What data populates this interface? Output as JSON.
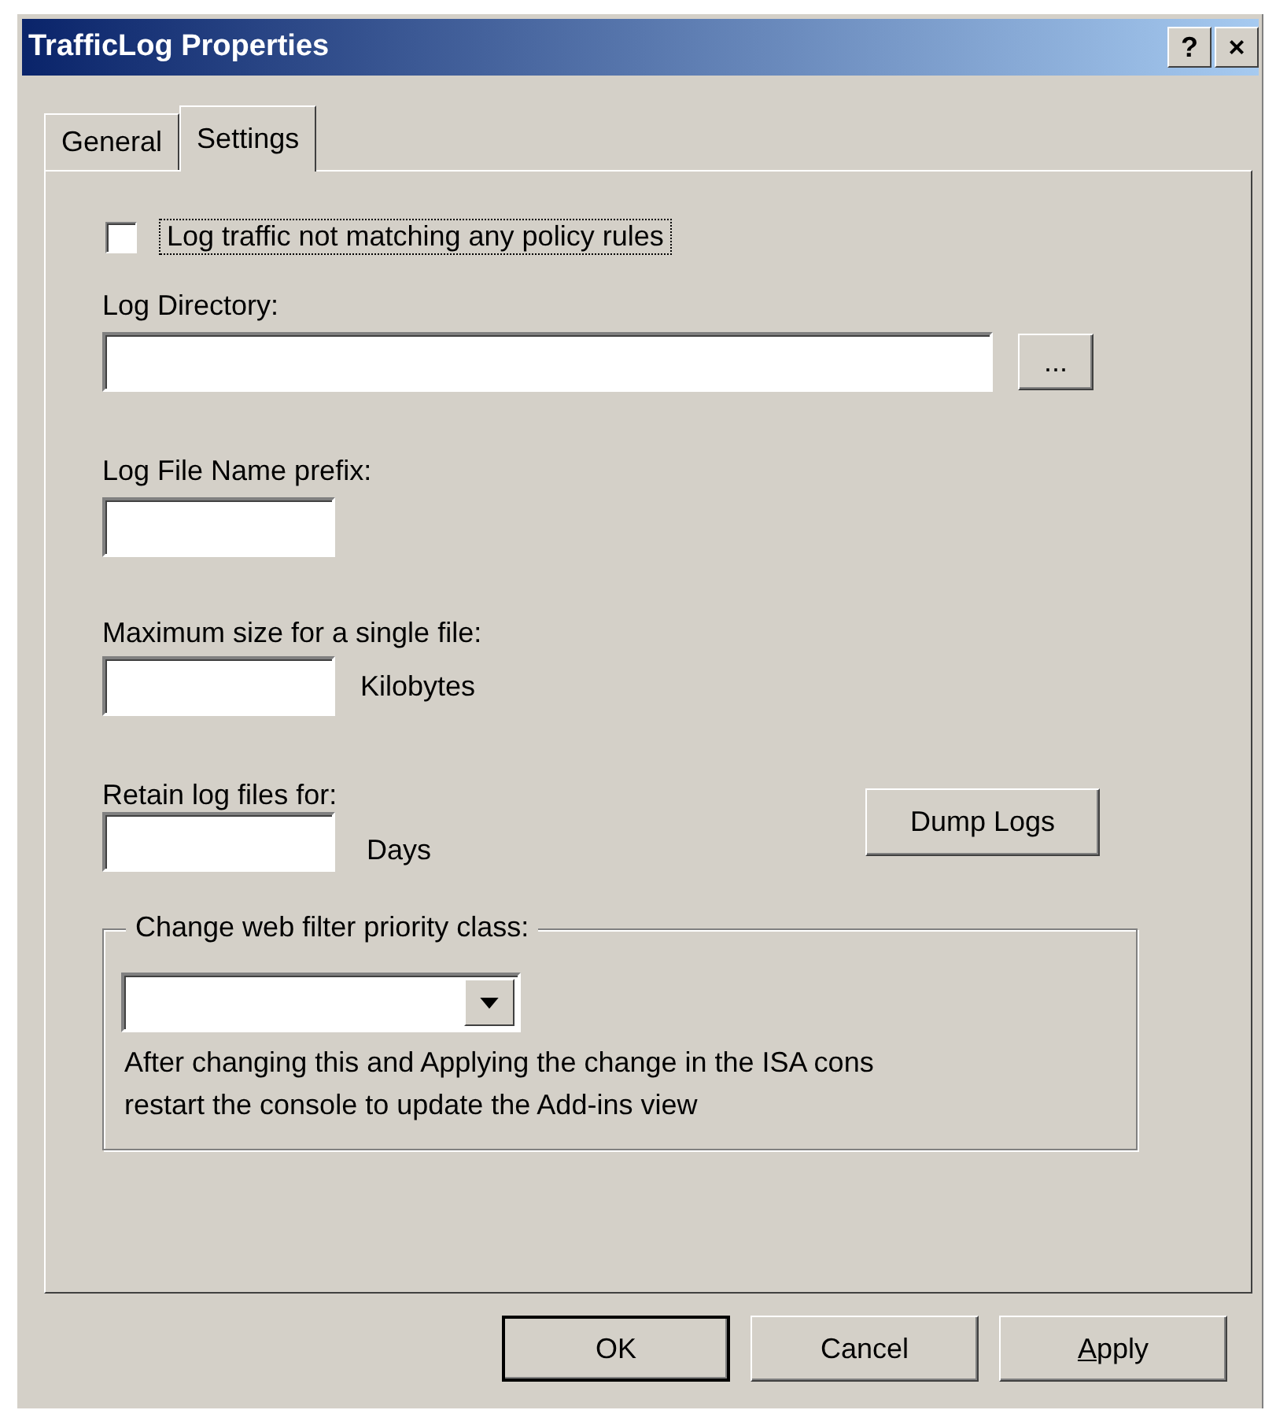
{
  "window": {
    "title": "TrafficLog Properties",
    "title_buttons": [
      "?",
      "×"
    ]
  },
  "tabs": [
    {
      "label": "General",
      "selected": false
    },
    {
      "label": "Settings",
      "selected": true
    }
  ],
  "log_unmatched": {
    "label": "Log traffic not matching any policy rules",
    "checked": false,
    "focused": true
  },
  "log_directory": {
    "label": "Log Directory:",
    "browse_button": "..."
  },
  "file_prefix": {
    "label": "Log File Name prefix:"
  },
  "max_size": {
    "label": "Maximum size for a single file:",
    "unit": "Kilobytes"
  },
  "retain": {
    "label": "Retain log files for:",
    "unit": "Days"
  },
  "dump_button": "Dump Logs",
  "priority_group": {
    "legend": "Change web filter priority class:",
    "note": "After changing this and Applying the change in the ISA cons\nrestart the console to update the Add-ins view"
  },
  "buttons": [
    {
      "label": "OK",
      "default": true,
      "access_key_underlined": false
    },
    {
      "label": "Cancel",
      "default": false,
      "access_key_underlined": false
    },
    {
      "label": "Apply",
      "default": false,
      "access_key_underlined": true
    }
  ]
}
